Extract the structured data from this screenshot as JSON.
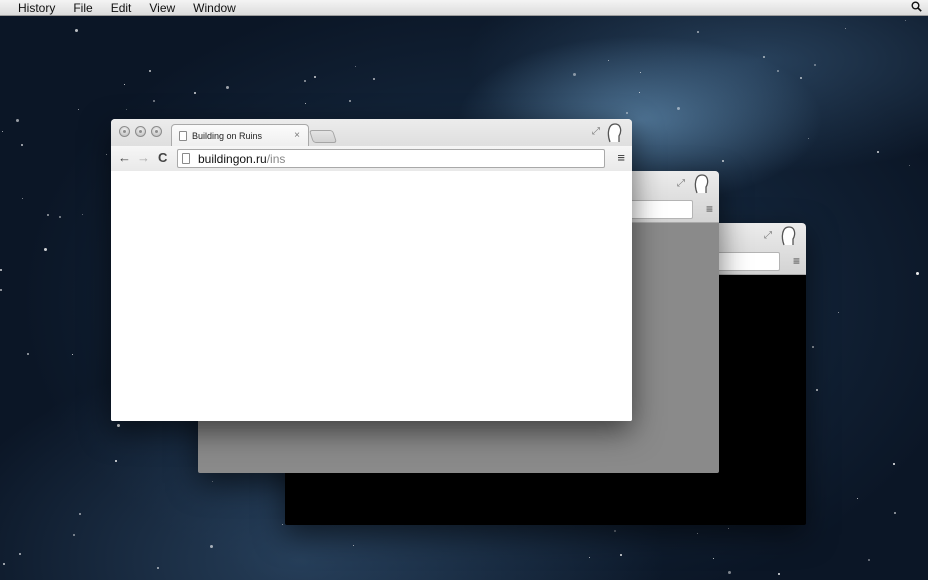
{
  "menubar": {
    "items": [
      "History",
      "File",
      "Edit",
      "View",
      "Window"
    ],
    "spotlight_icon": "search-icon"
  },
  "front_window": {
    "tab": {
      "title": "Building on Ruins",
      "close": "×"
    },
    "toolbar": {
      "back": "←",
      "forward": "→",
      "reload": "C",
      "url_domain": "buildingon.ru",
      "url_path": "/ins",
      "menu": "≡"
    },
    "expand_glyph": "⤢"
  },
  "back_windows": {
    "menu": "≡",
    "expand_glyph": "⤢"
  },
  "colors": {
    "window2_content": "#8a8a8a",
    "window3_content": "#000000",
    "front_content": "#ffffff"
  }
}
